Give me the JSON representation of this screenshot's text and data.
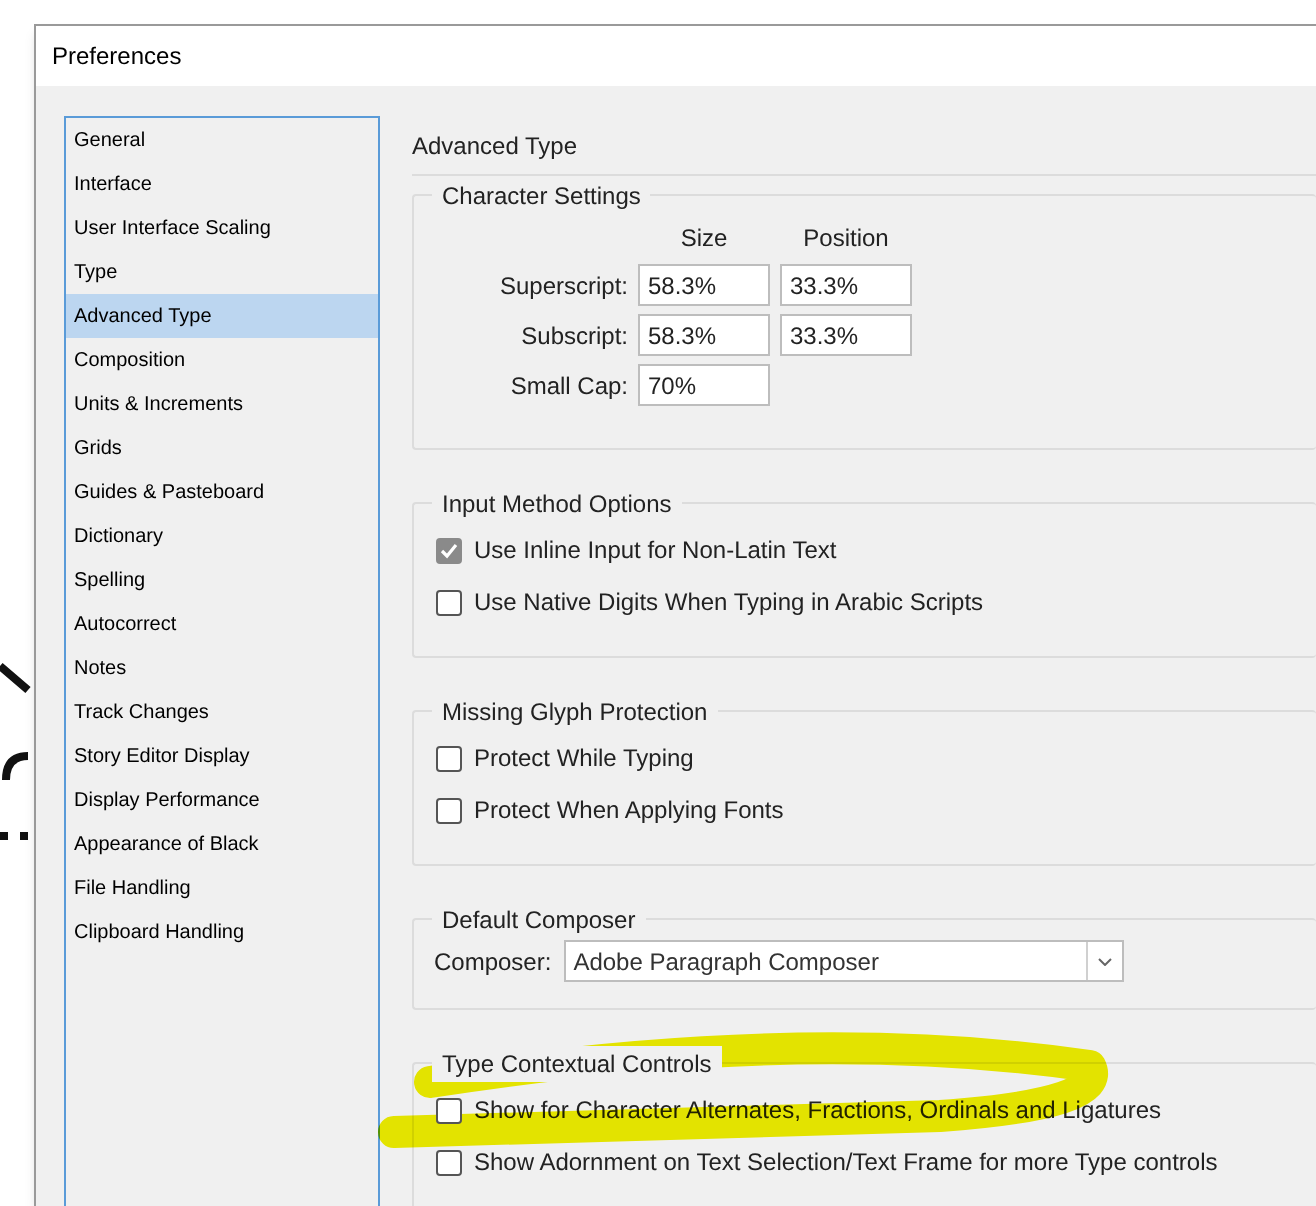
{
  "window": {
    "title": "Preferences"
  },
  "sidebar": {
    "items": [
      {
        "label": "General",
        "selected": false
      },
      {
        "label": "Interface",
        "selected": false
      },
      {
        "label": "User Interface Scaling",
        "selected": false
      },
      {
        "label": "Type",
        "selected": false
      },
      {
        "label": "Advanced Type",
        "selected": true
      },
      {
        "label": "Composition",
        "selected": false
      },
      {
        "label": "Units & Increments",
        "selected": false
      },
      {
        "label": "Grids",
        "selected": false
      },
      {
        "label": "Guides & Pasteboard",
        "selected": false
      },
      {
        "label": "Dictionary",
        "selected": false
      },
      {
        "label": "Spelling",
        "selected": false
      },
      {
        "label": "Autocorrect",
        "selected": false
      },
      {
        "label": "Notes",
        "selected": false
      },
      {
        "label": "Track Changes",
        "selected": false
      },
      {
        "label": "Story Editor Display",
        "selected": false
      },
      {
        "label": "Display Performance",
        "selected": false
      },
      {
        "label": "Appearance of Black",
        "selected": false
      },
      {
        "label": "File Handling",
        "selected": false
      },
      {
        "label": "Clipboard Handling",
        "selected": false
      }
    ]
  },
  "panel": {
    "title": "Advanced Type",
    "sections": [
      {
        "kind": "grid",
        "title": "Character Settings",
        "columns": [
          "Size",
          "Position"
        ],
        "rows": [
          {
            "label": "Superscript:",
            "values": [
              "58.3%",
              "33.3%"
            ]
          },
          {
            "label": "Subscript:",
            "values": [
              "58.3%",
              "33.3%"
            ]
          },
          {
            "label": "Small Cap:",
            "values": [
              "70%"
            ]
          }
        ]
      },
      {
        "kind": "checkboxes",
        "title": "Input Method Options",
        "options": [
          {
            "label": "Use Inline Input for Non-Latin Text",
            "checked": true
          },
          {
            "label": "Use Native Digits When Typing in Arabic Scripts",
            "checked": false
          }
        ]
      },
      {
        "kind": "checkboxes",
        "title": "Missing Glyph Protection",
        "options": [
          {
            "label": "Protect While Typing",
            "checked": false
          },
          {
            "label": "Protect When Applying Fonts",
            "checked": false
          }
        ]
      },
      {
        "kind": "dropdown",
        "title": "Default Composer",
        "label": "Composer:",
        "value": "Adobe Paragraph Composer"
      },
      {
        "kind": "checkboxes",
        "title": "Type Contextual Controls",
        "options": [
          {
            "label": "Show for Character Alternates, Fractions, Ordinals and Ligatures",
            "checked": false
          },
          {
            "label": "Show Adornment on Text Selection/Text Frame for more Type controls",
            "checked": false
          }
        ]
      }
    ]
  }
}
